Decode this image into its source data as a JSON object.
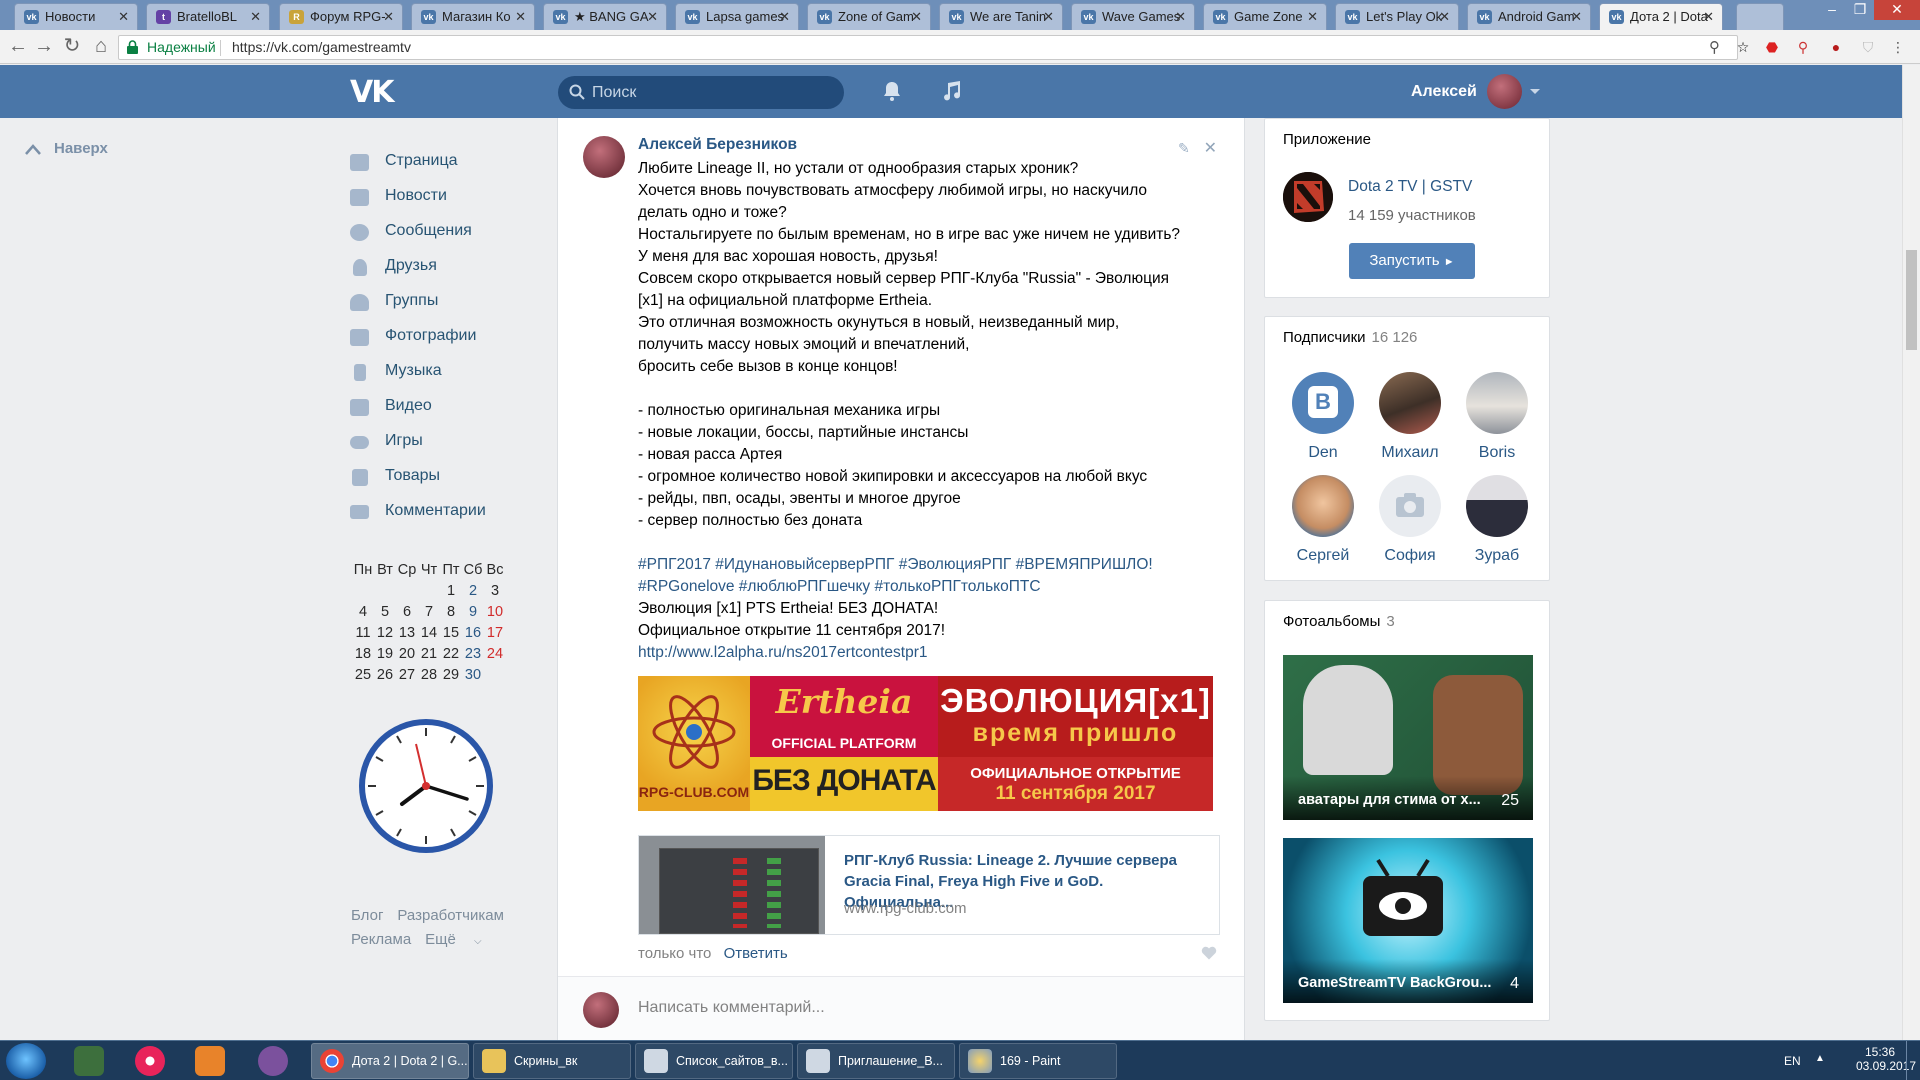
{
  "browser": {
    "tabs": [
      {
        "title": "Новости",
        "icon": "vk-icon"
      },
      {
        "title": "BratelloBL",
        "icon": "twitch-icon"
      },
      {
        "title": "Форум RPG-",
        "icon": "forum-icon"
      },
      {
        "title": "Магазин Ко",
        "icon": "vk-icon"
      },
      {
        "title": "★ BANG GA",
        "icon": "vk-icon"
      },
      {
        "title": "Lapsa games",
        "icon": "vk-icon"
      },
      {
        "title": "Zone of Gam",
        "icon": "vk-icon"
      },
      {
        "title": "We are Tanin",
        "icon": "vk-icon"
      },
      {
        "title": "Wave Games",
        "icon": "vk-icon"
      },
      {
        "title": "Game Zone",
        "icon": "vk-icon"
      },
      {
        "title": "Let's Play Ok",
        "icon": "vk-icon"
      },
      {
        "title": "Android Gam",
        "icon": "vk-icon"
      },
      {
        "title": "Дота 2 | Dota",
        "icon": "vk-icon",
        "active": true
      }
    ],
    "secure_label": "Надежный",
    "url": "https://vk.com/gamestreamtv"
  },
  "header": {
    "logo": "VK",
    "search_placeholder": "Поиск",
    "user_name": "Алексей"
  },
  "left": {
    "back_to_top": "Наверх",
    "nav": [
      {
        "label": "Страница",
        "icon": "home-icon"
      },
      {
        "label": "Новости",
        "icon": "news-icon"
      },
      {
        "label": "Сообщения",
        "icon": "messages-icon"
      },
      {
        "label": "Друзья",
        "icon": "friends-icon"
      },
      {
        "label": "Группы",
        "icon": "groups-icon"
      },
      {
        "label": "Фотографии",
        "icon": "photos-icon"
      },
      {
        "label": "Музыка",
        "icon": "music-icon"
      },
      {
        "label": "Видео",
        "icon": "video-icon"
      },
      {
        "label": "Игры",
        "icon": "games-icon"
      },
      {
        "label": "Товары",
        "icon": "goods-icon"
      },
      {
        "label": "Комментарии",
        "icon": "comments-icon"
      }
    ],
    "calendar": {
      "weekdays": [
        "Пн",
        "Вт",
        "Ср",
        "Чт",
        "Пт",
        "Сб",
        "Вс"
      ],
      "weeks": [
        [
          "",
          "",
          "",
          "",
          "1",
          "2",
          "3"
        ],
        [
          "4",
          "5",
          "6",
          "7",
          "8",
          "9",
          "10"
        ],
        [
          "11",
          "12",
          "13",
          "14",
          "15",
          "16",
          "17"
        ],
        [
          "18",
          "19",
          "20",
          "21",
          "22",
          "23",
          "24"
        ],
        [
          "25",
          "26",
          "27",
          "28",
          "29",
          "30",
          ""
        ]
      ]
    },
    "footer": [
      "Блог",
      "Разработчикам",
      "Реклама",
      "Ещё"
    ]
  },
  "post": {
    "author": "Алексей Березников",
    "lines": [
      "Любите Lineage II, но устали от однообразия старых хроник?",
      "Хочется вновь почувствовать атмосферу любимой игры, но наскучило",
      "делать одно и тоже?",
      "Ностальгируете по былым временам, но в игре вас уже ничем не удивить?",
      "У меня для вас хорошая новость, друзья!",
      "Совсем скоро открывается новый сервер РПГ-Клуба \"Russia\" - Эволюция",
      "[x1] на официальной платформе Ertheia.",
      "Это отличная возможность окунуться в новый, неизведанный мир,",
      "получить массу новых эмоций и впечатлений,",
      "бросить себе вызов в конце концов!",
      "",
      "- полностью оригинальная механика игры",
      "- новые локации, боссы, партийные инстансы",
      "- новая расса Артея",
      "- огромное количество новой экипировки и аксессуаров на любой вкус",
      "- рейды, пвп, осады, эвенты и многое другое",
      "- сервер полностью без доната",
      ""
    ],
    "hashtags_1": "#РПГ2017 #ИдунановыйсерверРПГ #ЭволюцияРПГ #ВРЕМЯПРИШЛО!",
    "hashtags_2": "#RPGonelove #люблюРПГшечку #толькоРПГтолькоПТС",
    "line_after_1": "Эволюция [x1] PTS Ertheia! БЕЗ ДОНАТА!",
    "line_after_2": "Официальное открытие 11 сентября 2017!",
    "link": "http://www.l2alpha.ru/ns2017ertcontestpr1",
    "banner": {
      "logo_text": "RPG-CLUB.COM",
      "ertheia": "Ertheia",
      "official_platform": "OFFICIAL PLATFORM",
      "no_donate": "БЕЗ ДОНАТА",
      "evolution": "ЭВОЛЮЦИЯ[x1]",
      "time_has_come": "время пришло",
      "official_opening": "ОФИЦИАЛЬНОЕ ОТКРЫТИЕ",
      "date": "11 сентября 2017"
    },
    "card": {
      "title": "РПГ-Клуб Russia: Lineage 2. Лучшие сервера Gracia Final, Freya High Five и GoD. Официальна...",
      "domain": "www.rpg-club.com"
    },
    "time": "только что",
    "reply": "Ответить",
    "comment_placeholder": "Написать комментарий..."
  },
  "right": {
    "app": {
      "heading": "Приложение",
      "name": "Dota 2 TV | GSTV",
      "members": "14 159 участников",
      "launch": "Запустить"
    },
    "subscribers": {
      "heading": "Подписчики",
      "count": "16 126",
      "people": [
        "Den",
        "Михаил",
        "Boris",
        "Сергей",
        "София",
        "Зураб"
      ]
    },
    "albums": {
      "heading": "Фотоальбомы",
      "count": "3",
      "items": [
        {
          "title": "аватары для стима от х...",
          "count": "25"
        },
        {
          "title": "GameStreamTV BackGrou...",
          "count": "4"
        }
      ]
    }
  },
  "taskbar": {
    "items": [
      {
        "label": "Дота 2 | Dota 2 | G...",
        "active": true
      },
      {
        "label": "Скрины_вк"
      },
      {
        "label": "Список_сайтов_в..."
      },
      {
        "label": "Приглашение_В..."
      },
      {
        "label": "169 - Paint"
      }
    ],
    "lang": "EN",
    "time": "15:36",
    "date": "03.09.2017"
  }
}
